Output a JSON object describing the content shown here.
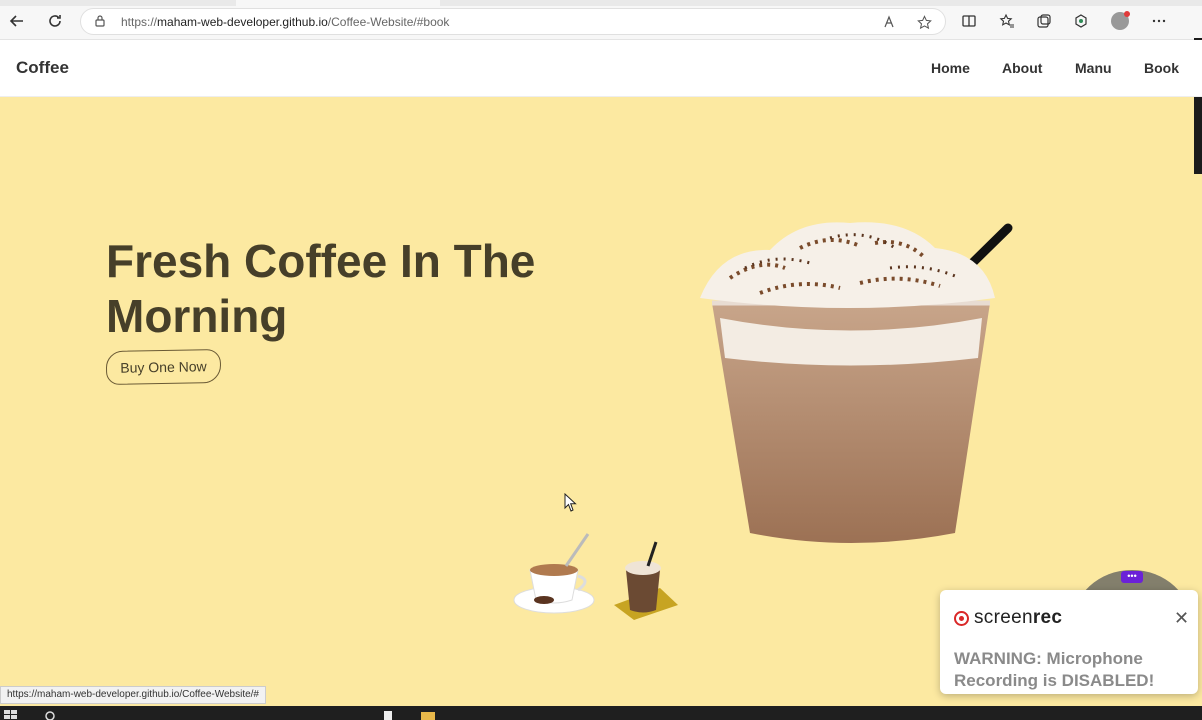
{
  "browser": {
    "url_prefix": "https://",
    "url_host": "maham-web-developer.github.io",
    "url_path": "/Coffee-Website/#book",
    "status_url": "https://maham-web-developer.github.io/Coffee-Website/#"
  },
  "site": {
    "brand": "Coffee",
    "nav": [
      "Home",
      "About",
      "Manu",
      "Book"
    ]
  },
  "hero": {
    "title_line1": "Fresh Coffee In The",
    "title_line2": "Morning",
    "button_label": "Buy One Now"
  },
  "screenrec": {
    "logo_light": "screen",
    "logo_bold": "rec",
    "close": "✕",
    "dots": "•••",
    "warning": "WARNING: Microphone Recording is DISABLED!"
  },
  "colors": {
    "hero_bg": "#fce9a1",
    "title": "#463f29",
    "record_red": "#d92828",
    "record_purple": "#6b21d8"
  }
}
